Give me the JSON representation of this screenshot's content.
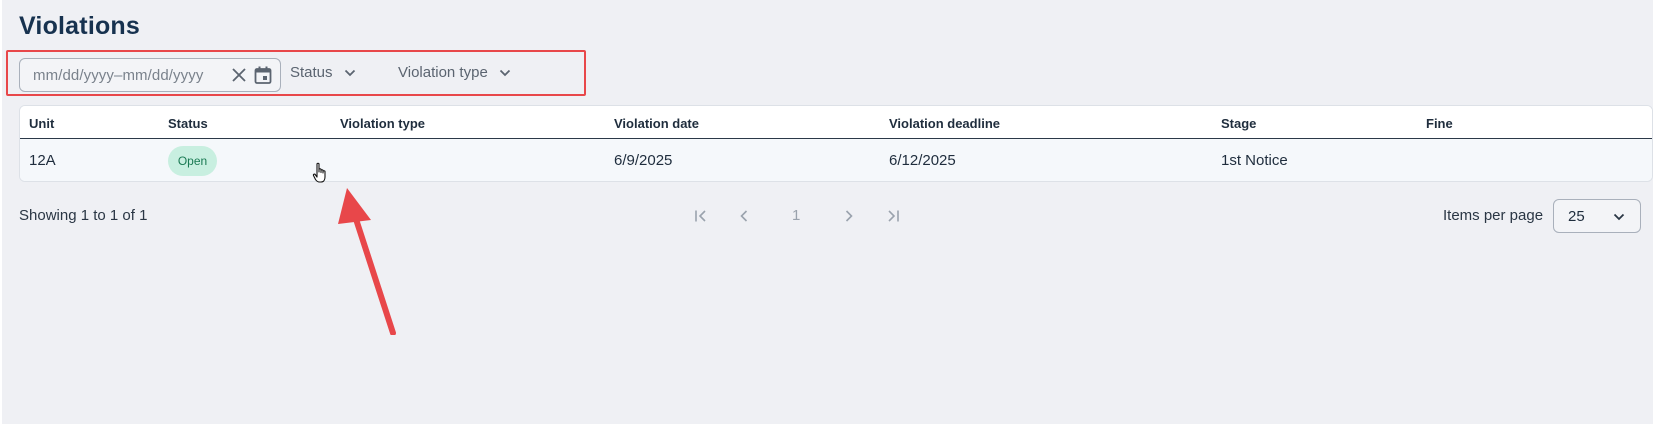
{
  "page": {
    "title": "Violations"
  },
  "filters": {
    "date_range_placeholder": "mm/dd/yyyy–mm/dd/yyyy",
    "status_label": "Status",
    "violation_type_label": "Violation type"
  },
  "table": {
    "columns": [
      "Unit",
      "Status",
      "Violation type",
      "Violation date",
      "Violation deadline",
      "Stage",
      "Fine"
    ],
    "rows": [
      {
        "unit": "12A",
        "status": "Open",
        "violation_type": "",
        "violation_date": "6/9/2025",
        "violation_deadline": "6/12/2025",
        "stage": "1st Notice",
        "fine": ""
      }
    ]
  },
  "pagination": {
    "showing_text": "Showing 1 to 1 of 1",
    "current_page": "1",
    "items_per_page_label": "Items per page",
    "items_per_page_value": "25"
  },
  "colors": {
    "highlight": "#e8474a",
    "status_open_bg": "#c8efe0",
    "status_open_text": "#1a7a53",
    "title": "#17324f"
  },
  "icons": [
    "clear-icon",
    "calendar-icon",
    "chevron-down-icon",
    "first-page-icon",
    "prev-page-icon",
    "next-page-icon",
    "last-page-icon",
    "hand-cursor-icon",
    "annotation-arrow"
  ]
}
